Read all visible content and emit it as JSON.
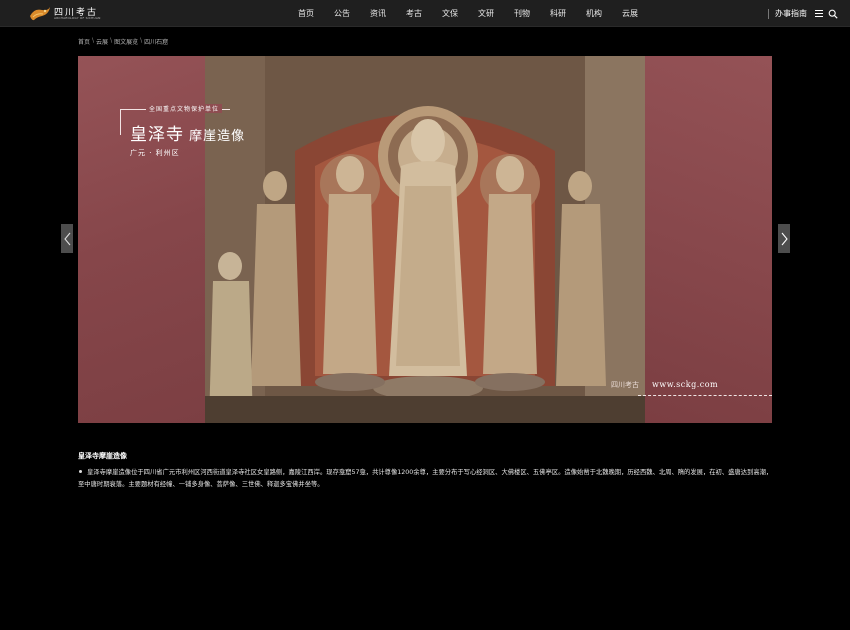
{
  "header": {
    "logo_text": "四川考古",
    "logo_sub": "ARCHAEOLOGY OF SICHUAN",
    "nav": [
      "首页",
      "公告",
      "资讯",
      "考古",
      "文保",
      "文研",
      "刊物",
      "科研",
      "机构",
      "云展"
    ],
    "guide_label": "办事指南"
  },
  "breadcrumb": [
    "首页",
    "云展",
    "图文展览",
    "四川石窟"
  ],
  "banner": {
    "kicker": "全国重点文物保护单位",
    "title_big": "皇泽寺",
    "title_small": "摩崖造像",
    "location": "广元 · 利州区",
    "url_prefix": "四川考古",
    "url": "www.sckg.com"
  },
  "content": {
    "title": "皇泽寺摩崖造像",
    "body": "皇泽寺摩崖造像位于四川省广元市利州区河西街道皇泽寺社区女皇路侧，嘉陵江西岸。现存龛窟57龛，共计尊像1200余尊，主要分布于写心经洞区、大佛楼区、五佛亭区。造像始凿于北魏晚期，历经西魏、北周、隋的发展，在初、盛唐达到高潮，至中唐时期衰落。主要题材有经幢、一铺多身像、菩萨像、三世佛、释迦多宝佛并坐等。"
  },
  "colors": {
    "header_bg": "#1f1f1f",
    "banner_bg": "#8a4a4d",
    "page_bg": "#000000"
  }
}
